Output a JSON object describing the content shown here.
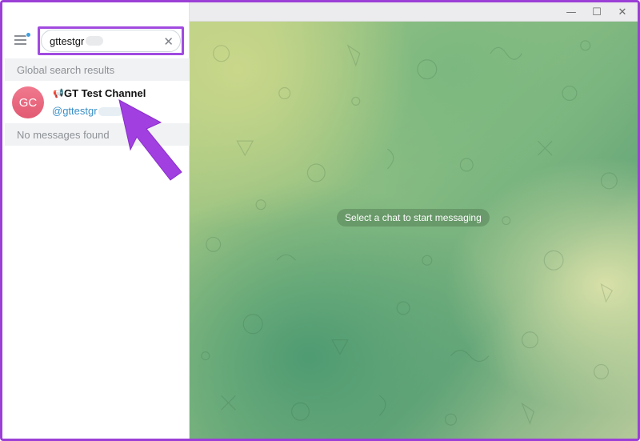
{
  "window": {
    "minimize_icon": "minimize-icon",
    "maximize_icon": "maximize-icon",
    "close_icon": "close-icon",
    "minimize_glyph": "—",
    "maximize_glyph": "☐",
    "close_glyph": "✕"
  },
  "sidebar": {
    "menu_icon": "hamburger-menu-icon",
    "search": {
      "value": "gttestgr",
      "clear_glyph": "✕"
    },
    "global_header": "Global search results",
    "results": [
      {
        "avatar_initials": "GC",
        "type_glyph": "📢",
        "name": "GT Test Channel",
        "handle": "@gttestgr"
      }
    ],
    "messages_header": "No messages found"
  },
  "chat": {
    "empty_text": "Select a chat to start messaging"
  },
  "colors": {
    "accent_border": "#9b3fd6",
    "arrow": "#a13fe0",
    "avatar": "#e9667e",
    "link": "#3a8fc7"
  }
}
